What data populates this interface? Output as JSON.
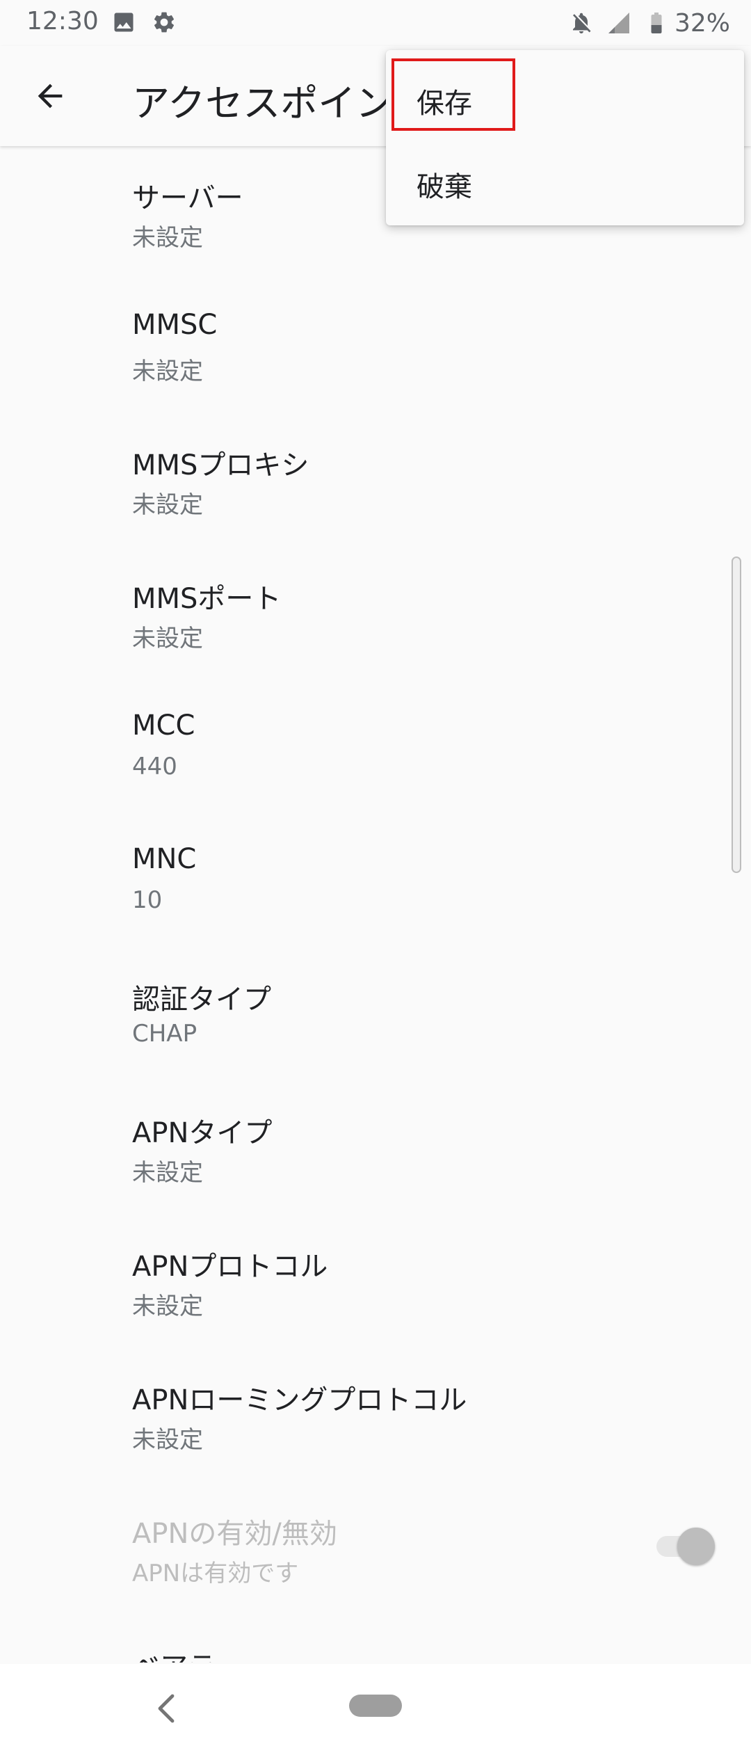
{
  "status_bar": {
    "time": "12:30",
    "battery_percent": "32%",
    "icons": [
      "image-icon",
      "settings-gear-icon",
      "notifications-off-icon",
      "signal-icon",
      "battery-icon"
    ]
  },
  "app_bar": {
    "title": "アクセスポイント",
    "back_icon": "back-arrow-icon"
  },
  "overflow_menu": {
    "items": [
      {
        "label": "保存"
      },
      {
        "label": "破棄"
      }
    ],
    "highlight_color": "#e01a1a"
  },
  "preferences": [
    {
      "title": "サーバー",
      "summary": "未設定"
    },
    {
      "title": "MMSC",
      "summary": "未設定"
    },
    {
      "title": "MMSプロキシ",
      "summary": "未設定"
    },
    {
      "title": "MMSポート",
      "summary": "未設定"
    },
    {
      "title": "MCC",
      "summary": "440"
    },
    {
      "title": "MNC",
      "summary": "10"
    },
    {
      "title": "認証タイプ",
      "summary": "CHAP"
    },
    {
      "title": "APNタイプ",
      "summary": "未設定"
    },
    {
      "title": "APNプロトコル",
      "summary": "未設定"
    },
    {
      "title": "APNローミングプロトコル",
      "summary": "未設定"
    },
    {
      "title": "APNの有効/無効",
      "summary": "APNは有効です",
      "enabled": false,
      "toggle_on": true
    },
    {
      "title": "ベアラー",
      "summary": ""
    }
  ],
  "nav_bar": {
    "icons": [
      "nav-back-icon",
      "nav-home-pill-icon"
    ]
  }
}
